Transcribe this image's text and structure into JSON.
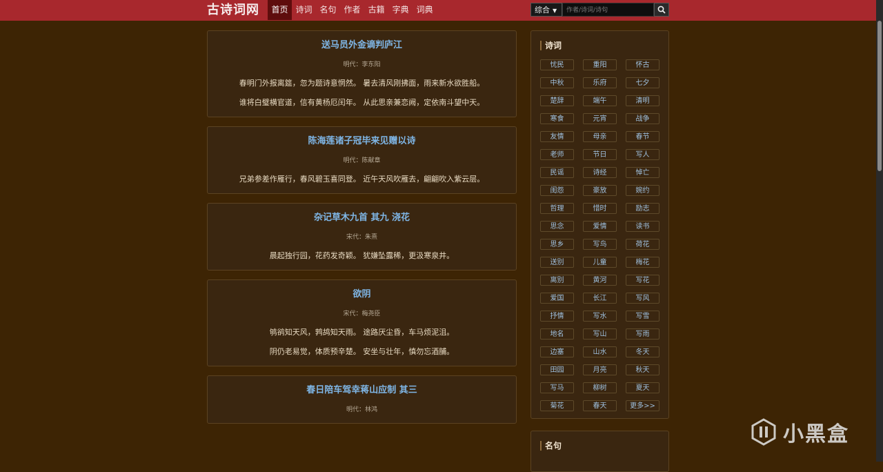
{
  "header": {
    "logo": "古诗词网",
    "nav": [
      {
        "label": "首页",
        "active": true
      },
      {
        "label": "诗词",
        "active": false
      },
      {
        "label": "名句",
        "active": false
      },
      {
        "label": "作者",
        "active": false
      },
      {
        "label": "古籍",
        "active": false
      },
      {
        "label": "字典",
        "active": false
      },
      {
        "label": "词典",
        "active": false
      }
    ],
    "search": {
      "select": "综合",
      "placeholder": "作者/诗词/诗句"
    }
  },
  "poems": [
    {
      "title": "送马员外金谪判庐江",
      "meta": "明代：李东阳",
      "lines": [
        "春明门外报离筵，忽为题诗意惘然。 暑去清风刚拂面，雨来新水欲胜船。",
        "谁将白璧横官道，信有黄杨厄闰年。 从此思亲兼恋阙，定依南斗望中天。"
      ]
    },
    {
      "title": "陈海莲诸子冠毕来见赠以诗",
      "meta": "明代：陈献章",
      "lines": [
        "兄弟参差作雁行，春风碧玉喜同登。 近午天风吹雁去，翩翩吹入紫云层。"
      ]
    },
    {
      "title": "杂记草木九首 其九 浇花",
      "meta": "宋代：朱熹",
      "lines": [
        "晨起独行园，花药发奇颖。 犹嫌坠露稀，更汲寒泉井。"
      ]
    },
    {
      "title": "欲阴",
      "meta": "宋代：梅尧臣",
      "lines": [
        "鸲鹆知天风，鹁鸪知天雨。 途路厌尘昏，车马烦泥沮。",
        "阴仍老易觉，体质预辛楚。 安坐与壮年，慎勿忘酒脯。"
      ]
    },
    {
      "title": "春日陪车驾幸蒋山应制 其三",
      "meta": "明代：林鸿",
      "lines": []
    }
  ],
  "sidebar": {
    "title": "诗词",
    "tags": [
      "忧民",
      "重阳",
      "怀古",
      "中秋",
      "乐府",
      "七夕",
      "楚辞",
      "端午",
      "清明",
      "寒食",
      "元宵",
      "战争",
      "友情",
      "母亲",
      "春节",
      "老师",
      "节日",
      "写人",
      "民谣",
      "诗经",
      "悼亡",
      "闺怨",
      "豪放",
      "婉约",
      "哲理",
      "惜时",
      "励志",
      "思念",
      "爱情",
      "读书",
      "思乡",
      "写鸟",
      "荷花",
      "送别",
      "儿童",
      "梅花",
      "离别",
      "黄河",
      "写花",
      "爱国",
      "长江",
      "写风",
      "抒情",
      "写水",
      "写雪",
      "地名",
      "写山",
      "写雨",
      "边塞",
      "山水",
      "冬天",
      "田园",
      "月亮",
      "秋天",
      "写马",
      "柳树",
      "夏天",
      "菊花",
      "春天",
      "更多>>"
    ],
    "title2": "名句"
  },
  "watermark": "小黑盒",
  "colors": {
    "topbar": "#a8282d",
    "background": "#3d2404",
    "card": "#3a2610",
    "title": "#7fb6e6"
  }
}
